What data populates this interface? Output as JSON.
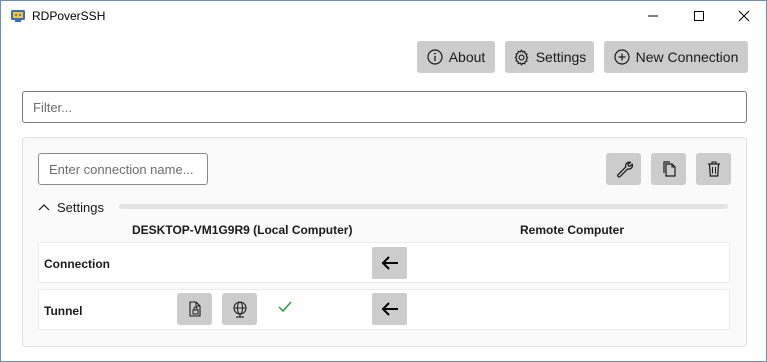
{
  "window": {
    "title": "RDPoverSSH",
    "controls": [
      "minimize",
      "maximize",
      "close"
    ]
  },
  "toolbar": {
    "about_label": "About",
    "settings_label": "Settings",
    "new_connection_label": "New Connection"
  },
  "filter": {
    "placeholder": "Filter...",
    "value": ""
  },
  "connection": {
    "name_placeholder": "Enter connection name...",
    "name_value": "",
    "settings_label": "Settings",
    "settings_expanded": true,
    "local_header": "DESKTOP-VM1G9R9 (Local Computer)",
    "remote_header": "Remote Computer",
    "rows": [
      {
        "label": "Connection"
      },
      {
        "label": "Tunnel"
      }
    ],
    "tunnel_status": "ok"
  },
  "icons": {
    "app": "app-icon",
    "about": "info-icon",
    "settings": "gear-icon",
    "new": "plus-circle-icon",
    "edit": "wrench-icon",
    "copy": "copy-icon",
    "delete": "trash-icon",
    "direction": "arrow-left-icon",
    "file": "file-lock-icon",
    "globe": "globe-icon",
    "status": "check-icon"
  },
  "colors": {
    "button_bg": "#cccccc",
    "check": "#2e9d3a",
    "window_border": "#6b8fb3"
  }
}
